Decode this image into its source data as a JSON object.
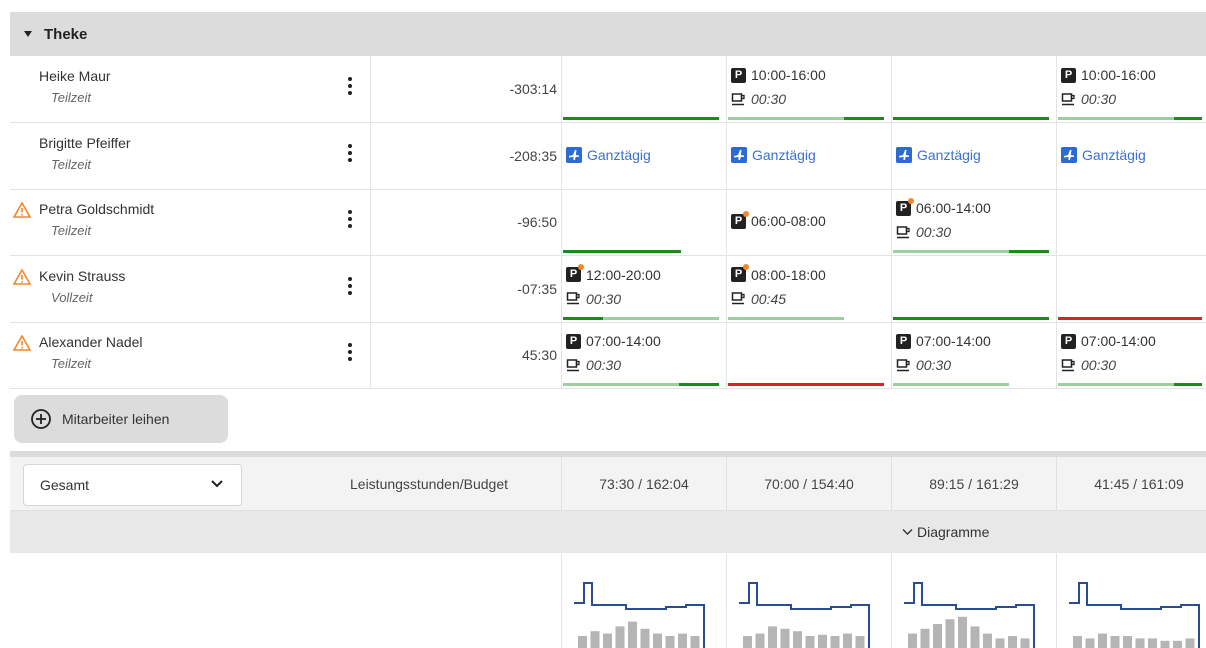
{
  "group": {
    "title": "Theke"
  },
  "employees": [
    {
      "name": "Heike Maur",
      "type": "Teilzeit",
      "warning": false,
      "balance": "-303:14",
      "days": [
        {
          "kind": "empty",
          "bars": [
            {
              "c": "#1e8a1e",
              "w": 156
            }
          ]
        },
        {
          "kind": "shift",
          "time": "10:00-16:00",
          "break": "00:30",
          "dot": false,
          "bars": [
            {
              "c": "#9bcf9b",
              "w": 116
            },
            {
              "c": "#1e8a1e",
              "w": 40
            }
          ]
        },
        {
          "kind": "empty",
          "bars": [
            {
              "c": "#1e8a1e",
              "w": 156
            }
          ]
        },
        {
          "kind": "shift",
          "time": "10:00-16:00",
          "break": "00:30",
          "dot": false,
          "bars": [
            {
              "c": "#9bcf9b",
              "w": 116
            },
            {
              "c": "#1e8a1e",
              "w": 28
            }
          ]
        }
      ]
    },
    {
      "name": "Brigitte Pfeiffer",
      "type": "Teilzeit",
      "warning": false,
      "balance": "-208:35",
      "days": [
        {
          "kind": "absence",
          "label": "Ganztägig"
        },
        {
          "kind": "absence",
          "label": "Ganztägig"
        },
        {
          "kind": "absence",
          "label": "Ganztägig"
        },
        {
          "kind": "absence",
          "label": "Ganztägig"
        }
      ]
    },
    {
      "name": "Petra Goldschmidt",
      "type": "Teilzeit",
      "warning": true,
      "balance": "-96:50",
      "days": [
        {
          "kind": "empty",
          "bars": [
            {
              "c": "#1e8a1e",
              "w": 118
            }
          ]
        },
        {
          "kind": "shift1",
          "time": "06:00-08:00",
          "dot": true,
          "bars": []
        },
        {
          "kind": "shift",
          "time": "06:00-14:00",
          "break": "00:30",
          "dot": true,
          "bars": [
            {
              "c": "#9bcf9b",
              "w": 116
            },
            {
              "c": "#1e8a1e",
              "w": 40
            }
          ]
        },
        {
          "kind": "empty",
          "bars": []
        }
      ]
    },
    {
      "name": "Kevin Strauss",
      "type": "Vollzeit",
      "warning": true,
      "balance": "-07:35",
      "days": [
        {
          "kind": "shift",
          "time": "12:00-20:00",
          "break": "00:30",
          "dot": true,
          "bars": [
            {
              "c": "#1e8a1e",
              "w": 40
            },
            {
              "c": "#9bcf9b",
              "w": 116
            }
          ]
        },
        {
          "kind": "shift",
          "time": "08:00-18:00",
          "break": "00:45",
          "dot": true,
          "bars": [
            {
              "c": "#9bcf9b",
              "w": 116
            }
          ]
        },
        {
          "kind": "empty",
          "bars": [
            {
              "c": "#1e8a1e",
              "w": 156
            }
          ]
        },
        {
          "kind": "empty",
          "bars": [
            {
              "c": "#e02020",
              "w": 144
            }
          ]
        }
      ]
    },
    {
      "name": "Alexander Nadel",
      "type": "Teilzeit",
      "warning": true,
      "balance": "45:30",
      "days": [
        {
          "kind": "shift",
          "time": "07:00-14:00",
          "break": "00:30",
          "dot": false,
          "bars": [
            {
              "c": "#9bcf9b",
              "w": 116
            },
            {
              "c": "#1e8a1e",
              "w": 40
            }
          ]
        },
        {
          "kind": "empty",
          "bars": [
            {
              "c": "#e02020",
              "w": 156
            }
          ]
        },
        {
          "kind": "shift",
          "time": "07:00-14:00",
          "break": "00:30",
          "dot": false,
          "bars": [
            {
              "c": "#9bcf9b",
              "w": 116
            }
          ]
        },
        {
          "kind": "shift",
          "time": "07:00-14:00",
          "break": "00:30",
          "dot": false,
          "bars": [
            {
              "c": "#9bcf9b",
              "w": 116
            },
            {
              "c": "#1e8a1e",
              "w": 28
            }
          ]
        }
      ]
    }
  ],
  "borrow_button": {
    "label": "Mitarbeiter leihen"
  },
  "summary": {
    "select_value": "Gesamt",
    "label": "Leistungsstunden/Budget",
    "values": [
      "73:30 / 162:04",
      "70:00 / 154:40",
      "89:15 / 161:29",
      "41:45 / 161:09"
    ]
  },
  "diagrams": {
    "toggle_label": "Diagramme"
  },
  "colors": {
    "bar_green": "#1e8a1e",
    "bar_lightgreen": "#9bcf9b",
    "bar_red": "#e02020",
    "absence_blue": "#3b6fd8",
    "warning_orange": "#f0882a",
    "chart_line": "#2a4d8f",
    "chart_bar": "#b5b5b5"
  }
}
